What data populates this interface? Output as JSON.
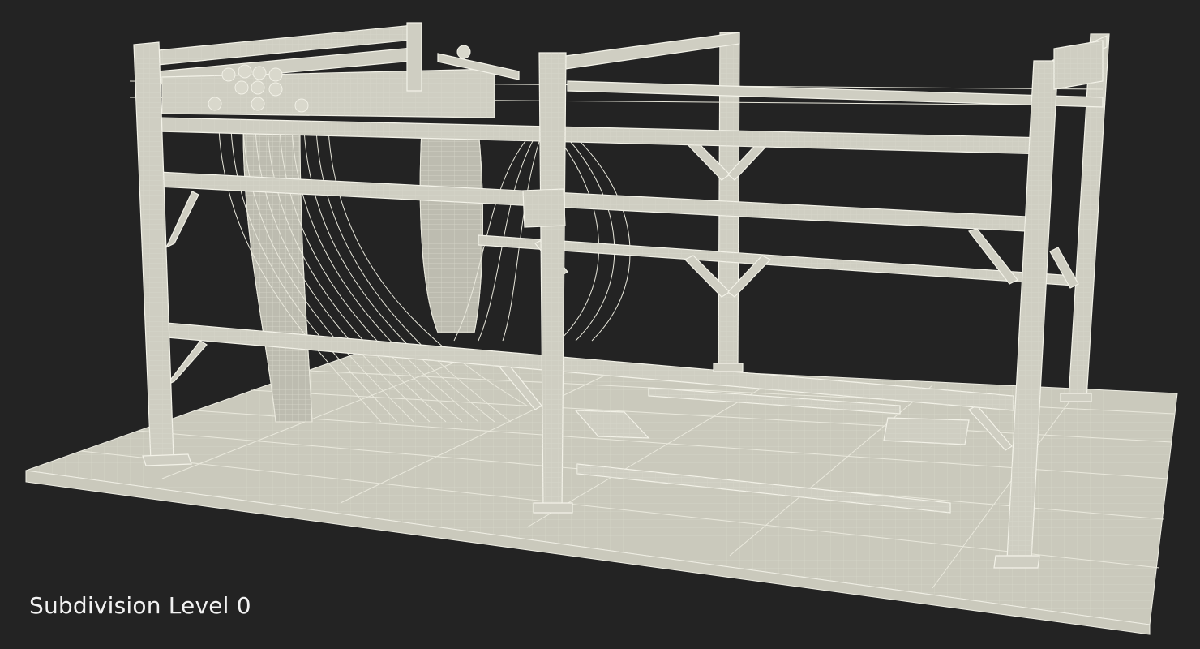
{
  "viewport": {
    "caption": "Subdivision Level 0"
  },
  "scene": {
    "object": "wireframe-steel-frame-with-cable-carrier",
    "background_color": "#232323",
    "wire_color": "#e9e8dc"
  }
}
